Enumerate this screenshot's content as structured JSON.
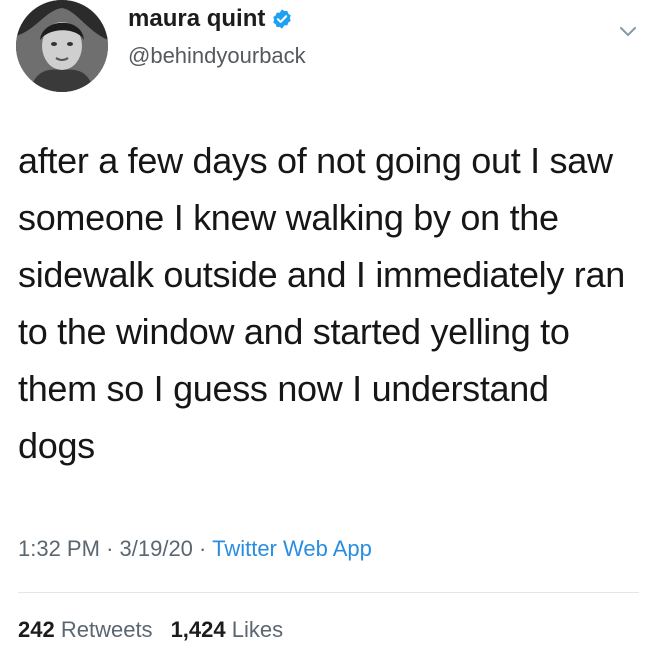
{
  "tweet": {
    "author": {
      "display_name": "maura quint",
      "handle": "@behindyourback",
      "verified": true
    },
    "text": "after a few days of not going out I saw\nsomeone I knew walking by on the\nsidewalk outside and I immediately ran\nto the window and started yelling to\nthem so I guess now I understand\ndogs",
    "time": "1:32 PM",
    "date": "3/19/20",
    "separator": "·",
    "source": "Twitter Web App",
    "stats": {
      "retweets_count": "242",
      "retweets_label": "Retweets",
      "likes_count": "1,424",
      "likes_label": "Likes"
    }
  },
  "icons": {
    "verified": "verified-badge-icon",
    "menu": "chevron-down-icon"
  },
  "colors": {
    "verified_blue": "#1da1f2",
    "link_blue": "#2a8ee0",
    "meta_gray": "#5b6670"
  }
}
